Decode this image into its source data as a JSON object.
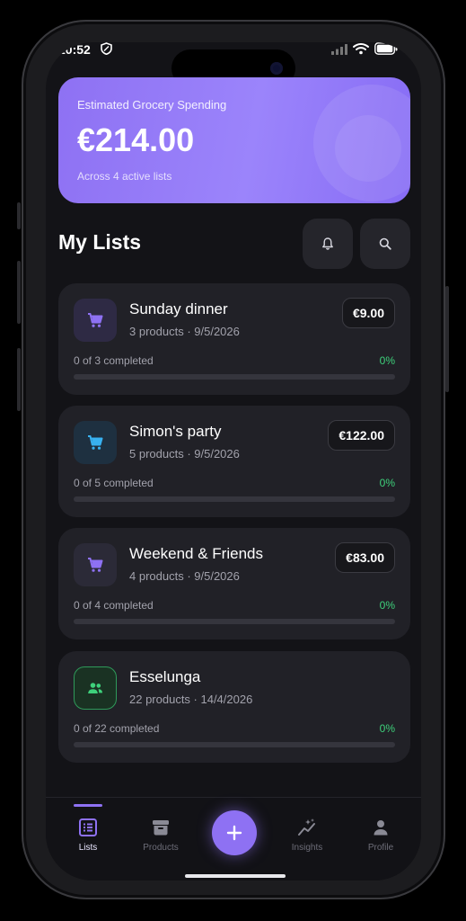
{
  "status_bar": {
    "time": "10:52"
  },
  "hero": {
    "label": "Estimated Grocery Spending",
    "amount": "€214.00",
    "subtitle": "Across 4 active lists"
  },
  "section": {
    "title": "My Lists"
  },
  "header_icons": [
    "bell-icon",
    "search-icon"
  ],
  "lists": [
    {
      "name": "Sunday dinner",
      "meta": "3 products · 9/5/2026",
      "price": "€9.00",
      "progress_label": "0 of 3 completed",
      "progress_pct": "0%",
      "progress": 0,
      "icon": "cart-icon",
      "icon_color": "#8e71f3",
      "icon_bg": "#2e2a44"
    },
    {
      "name": "Simon's party",
      "meta": "5 products · 9/5/2026",
      "price": "€122.00",
      "progress_label": "0 of 5 completed",
      "progress_pct": "0%",
      "progress": 0,
      "icon": "cart-icon",
      "icon_color": "#38b1f0",
      "icon_bg": "#1e3040"
    },
    {
      "name": "Weekend & Friends",
      "meta": "4 products · 9/5/2026",
      "price": "€83.00",
      "progress_label": "0 of 4 completed",
      "progress_pct": "0%",
      "progress": 0,
      "icon": "cart-icon",
      "icon_color": "#8e71f3",
      "icon_bg": "#2b2a37"
    },
    {
      "name": "Esselunga",
      "meta": "22 products · 14/4/2026",
      "price": "",
      "progress_label": "0 of 22 completed",
      "progress_pct": "0%",
      "progress": 0,
      "icon": "group-icon",
      "icon_color": "#3ed17b",
      "icon_bg": "#1a3223"
    }
  ],
  "nav": {
    "items": [
      {
        "label": "Lists",
        "icon": "lists-icon",
        "active": true
      },
      {
        "label": "Products",
        "icon": "archive-icon",
        "active": false
      },
      {
        "label": "",
        "icon": "plus-icon",
        "active": false
      },
      {
        "label": "Insights",
        "icon": "insights-icon",
        "active": false
      },
      {
        "label": "Profile",
        "icon": "profile-icon",
        "active": false
      }
    ]
  },
  "colors": {
    "accent": "#8e71f3",
    "success": "#3ed17b",
    "background": "#131317",
    "card": "#212127"
  }
}
